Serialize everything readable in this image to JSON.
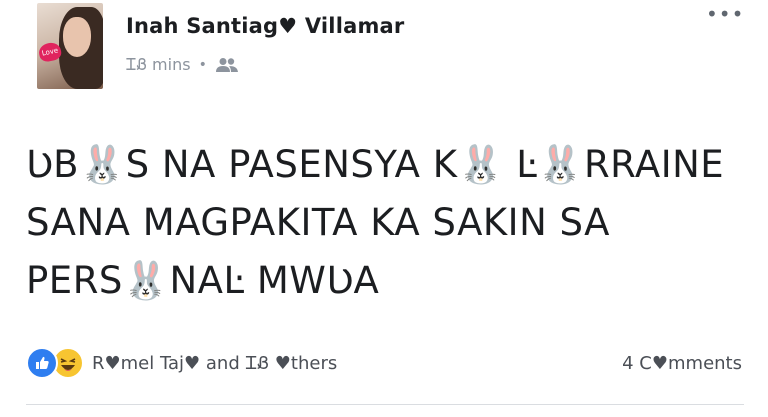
{
  "post": {
    "author_name": "Inah Santiag♥ Villamar",
    "time": "ᏆᏰ mins",
    "separator": "•",
    "privacy_icon": "friends-icon",
    "more_label": "•••",
    "text_lines": [
      "ƲB🐰S NA PASENSYA K🐰 Ŀ🐰RRAINE",
      "SANA MAGPAKITA KA SAKIN SA",
      "PERS🐰NAĿ MWƲA"
    ],
    "avatar_sticker_text": "Love"
  },
  "footer": {
    "reaction_icons": [
      "like-icon",
      "haha-icon"
    ],
    "reaction_names": "R♥mel Taj♥ and ᏆᏰ ♥thers",
    "comments": "4 C♥mments"
  },
  "colors": {
    "like_blue": "#2f7ef0",
    "haha_yellow": "#f7c531",
    "text": "#1c1e21",
    "meta": "#8d949e"
  }
}
